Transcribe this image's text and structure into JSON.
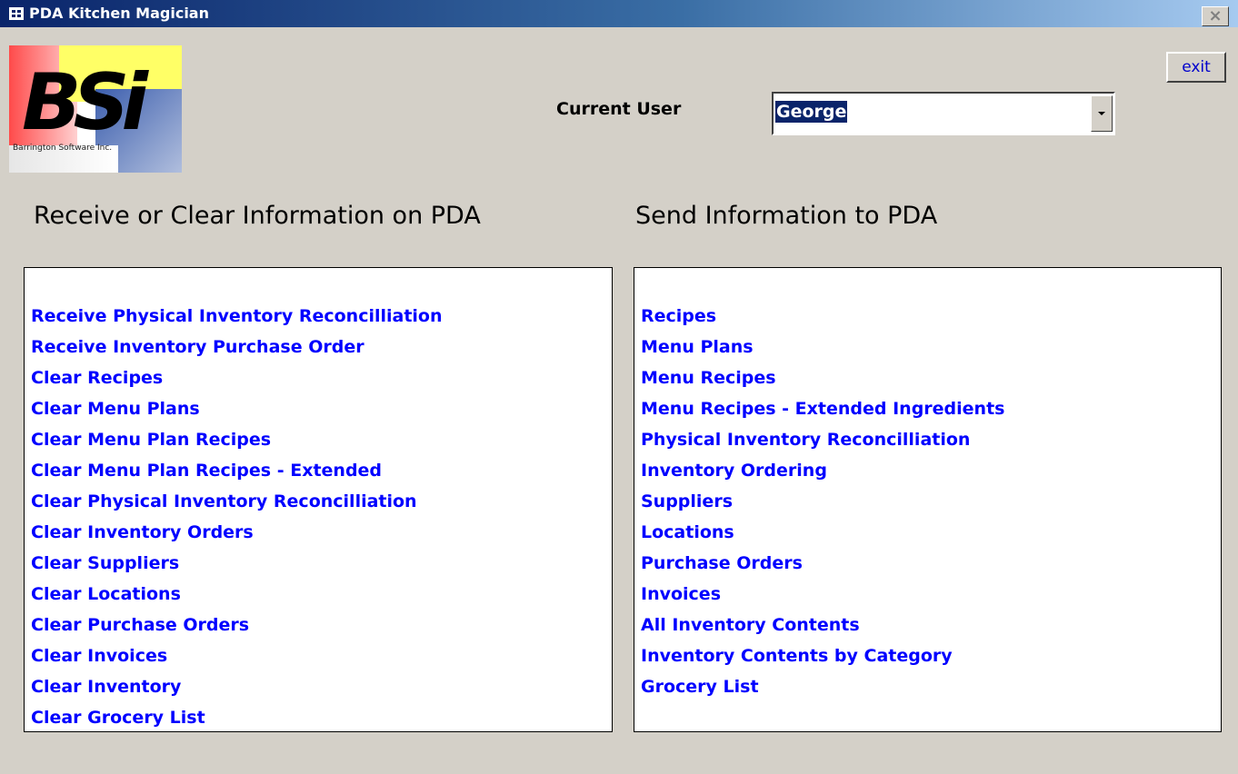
{
  "window": {
    "title": "PDA Kitchen Magician",
    "close_label": "×"
  },
  "logo": {
    "text": "BSi",
    "subtext": "Barrington Software Inc."
  },
  "toolbar": {
    "exit_label": "exit"
  },
  "user": {
    "label": "Current User",
    "selected": "George"
  },
  "receive_section": {
    "heading": "Receive or Clear Information on PDA",
    "items": [
      "Receive Physical Inventory Reconcilliation",
      "Receive Inventory Purchase Order",
      "Clear Recipes",
      "Clear Menu Plans",
      "Clear Menu Plan Recipes",
      "Clear Menu Plan Recipes - Extended",
      "Clear Physical Inventory Reconcilliation",
      "Clear Inventory Orders",
      "Clear Suppliers",
      "Clear Locations",
      "Clear Purchase Orders",
      "Clear Invoices",
      "Clear Inventory",
      "Clear Grocery List"
    ]
  },
  "send_section": {
    "heading": "Send Information to PDA",
    "items": [
      "Recipes",
      "Menu Plans",
      "Menu Recipes",
      "Menu Recipes - Extended Ingredients",
      "Physical Inventory Reconcilliation",
      "Inventory Ordering",
      "Suppliers",
      "Locations",
      "Purchase Orders",
      "Invoices",
      "All Inventory Contents",
      "Inventory Contents by Category",
      "Grocery List"
    ]
  },
  "colors": {
    "titlebar_start": "#0a246a",
    "titlebar_end": "#a6caf0",
    "link": "#0000ff",
    "background": "#d4d0c8",
    "selection": "#0a246a"
  }
}
